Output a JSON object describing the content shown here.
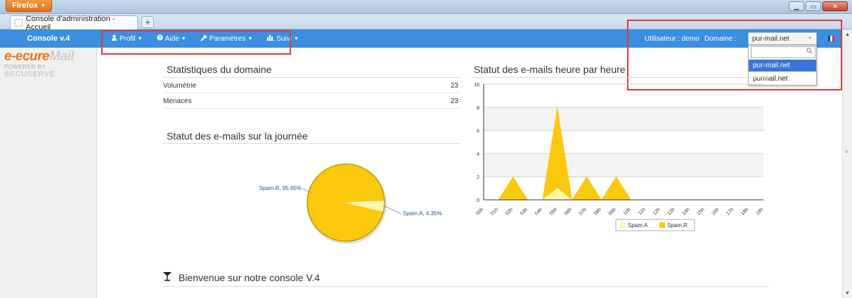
{
  "browser": {
    "app_button": "Firefox",
    "tab_title": "Console d'administration - Accueil",
    "new_tab": "+"
  },
  "nav": {
    "brand": "Console v.4",
    "menu": [
      {
        "label": "Profil",
        "icon": "user-icon"
      },
      {
        "label": "Aide",
        "icon": "help-icon"
      },
      {
        "label": "Paramètres",
        "icon": "wrench-icon"
      },
      {
        "label": "Suivi",
        "icon": "bar-chart-icon"
      }
    ],
    "user_label": "Utilisateur : demo",
    "domain_label": "Domaine :",
    "domain_selected": "pur-mail.net",
    "domain_options": [
      "pur-mail.net",
      "purmail.net"
    ],
    "flag": "fr-flag"
  },
  "logo": {
    "part1": "e-",
    "part2": "ecure",
    "part3": "Mail",
    "powered": "POWERED BY",
    "powered_brand": "SECUSERVE"
  },
  "stats": {
    "title": "Statistiques du domaine",
    "rows": [
      {
        "label": "Volumétrie",
        "value": "23"
      },
      {
        "label": "Menaces",
        "value": "23"
      }
    ]
  },
  "pie_section": {
    "title": "Statut des e-mails sur la journée"
  },
  "line_section": {
    "title": "Statut des e-mails heure par heure"
  },
  "welcome": {
    "icon": "glass-icon",
    "text": "Bienvenue sur notre console V.4"
  },
  "colors": {
    "navbar": "#3b8fe0",
    "spamR": "#fcc80c",
    "spamA": "#fff7a8",
    "selected": "#3875d7"
  },
  "chart_data": [
    {
      "type": "pie",
      "slices": [
        {
          "label": "Spam.R",
          "value": 95.65,
          "text": "Spam.R, 95.65%"
        },
        {
          "label": "Spam.A",
          "value": 4.35,
          "text": "Spam.A, 4.35%"
        }
      ]
    },
    {
      "type": "area",
      "x": [
        "00h",
        "01h",
        "02h",
        "03h",
        "04h",
        "05h",
        "06h",
        "07h",
        "08h",
        "09h",
        "10h",
        "11h",
        "12h",
        "13h",
        "14h",
        "15h",
        "16h",
        "17h",
        "18h",
        "19h"
      ],
      "ylim": [
        0,
        10
      ],
      "yticks": [
        0,
        2,
        4,
        6,
        8,
        10
      ],
      "series": [
        {
          "name": "Spam.A",
          "values": [
            0,
            0,
            0,
            0,
            0,
            1,
            0,
            0,
            0,
            0,
            0,
            0,
            0,
            0,
            0,
            0,
            0,
            0,
            0,
            0
          ]
        },
        {
          "name": "Spam.R",
          "values": [
            0,
            0,
            2,
            0,
            0,
            8,
            0,
            2,
            0,
            2,
            0,
            0,
            0,
            0,
            0,
            0,
            0,
            0,
            0,
            0
          ]
        }
      ],
      "legend": "bottom"
    }
  ]
}
